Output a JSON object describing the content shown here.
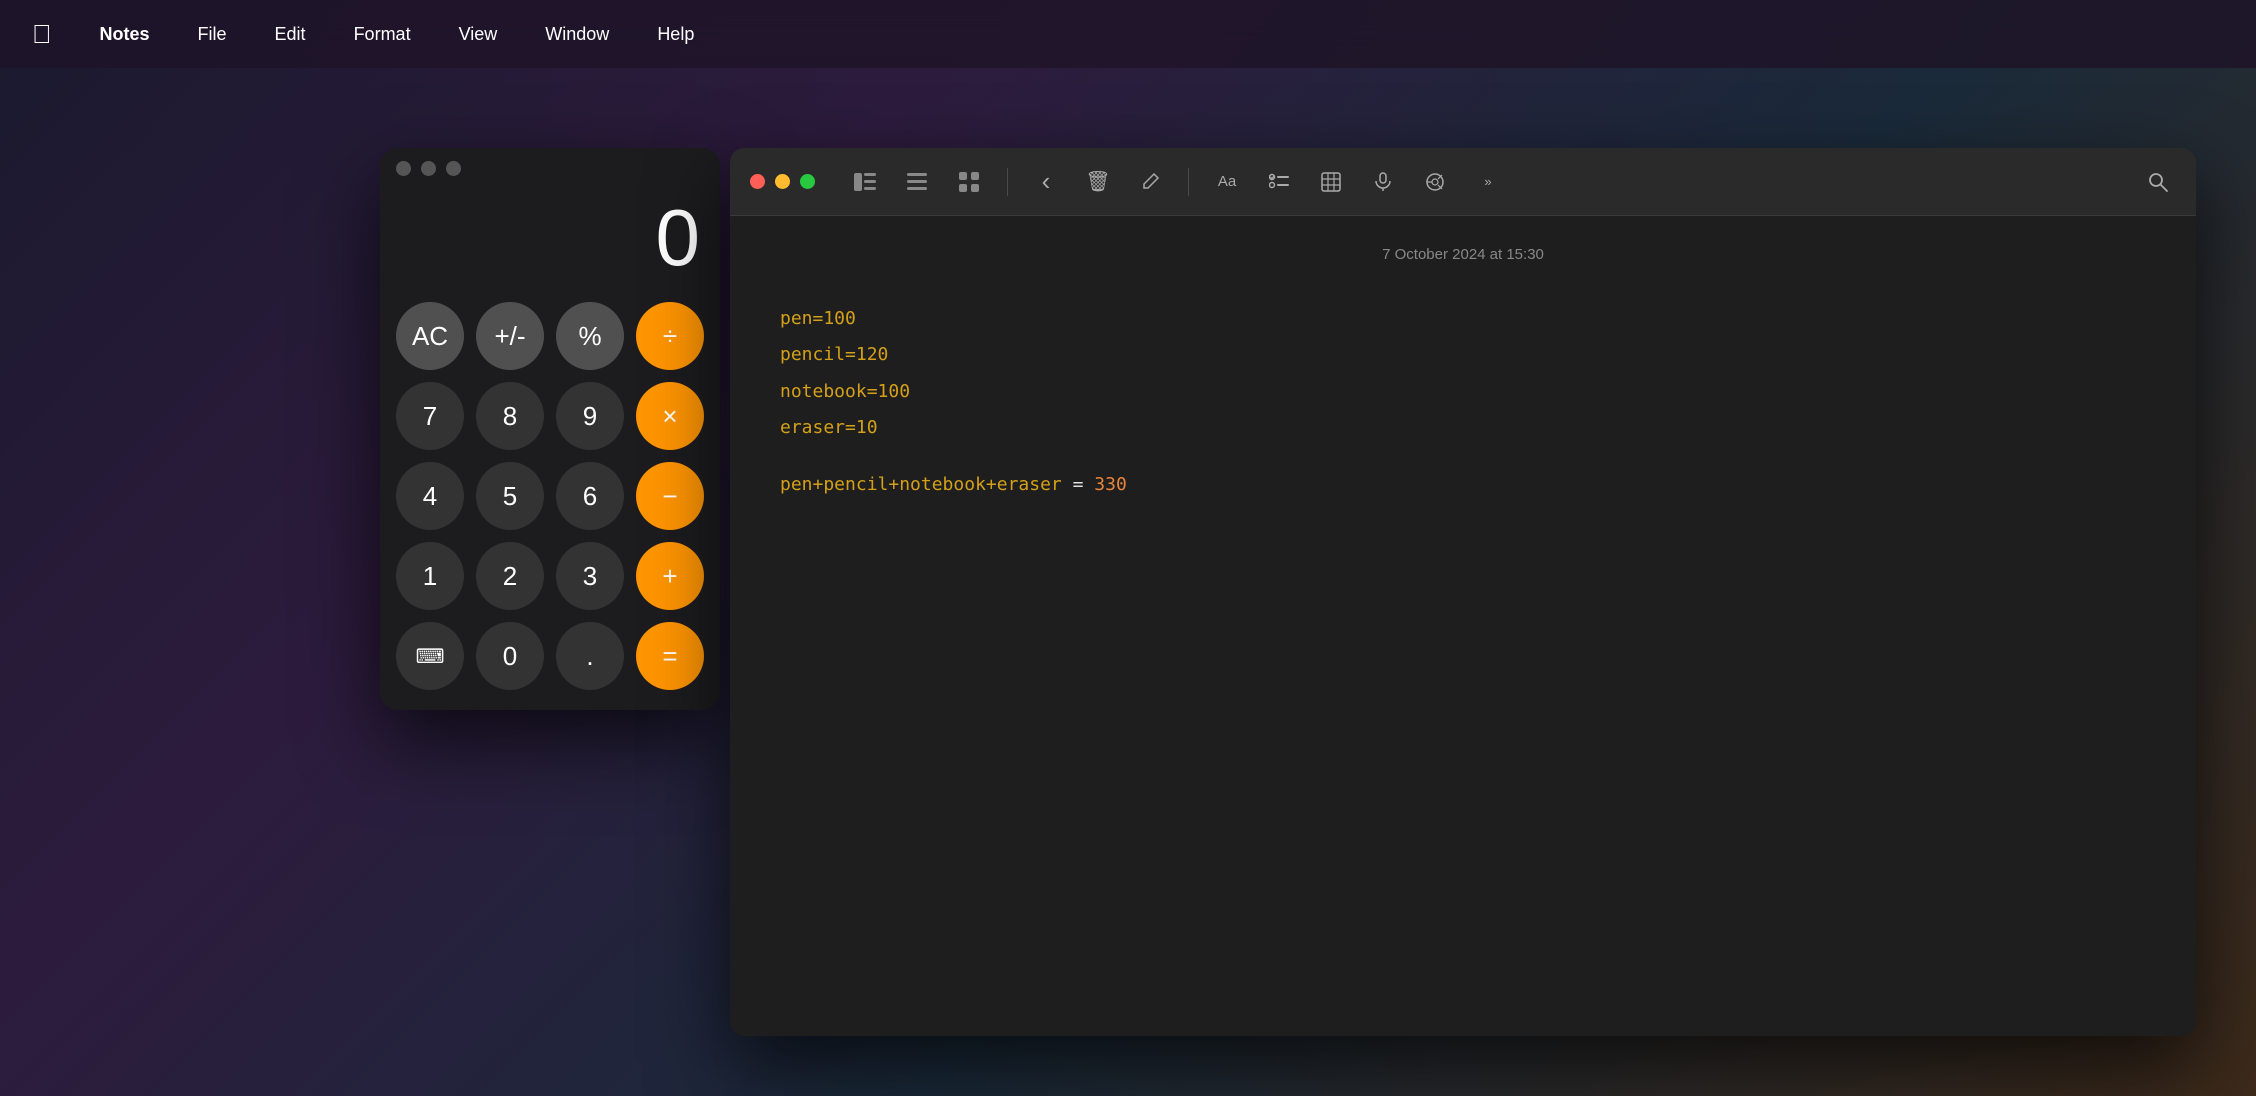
{
  "menubar": {
    "apple_icon": "&#63743;",
    "items": [
      {
        "label": "Notes",
        "active": true
      },
      {
        "label": "File"
      },
      {
        "label": "Edit"
      },
      {
        "label": "Format"
      },
      {
        "label": "View"
      },
      {
        "label": "Window"
      },
      {
        "label": "Help"
      }
    ]
  },
  "calculator": {
    "display": "0",
    "buttons": [
      {
        "label": "AC",
        "type": "gray"
      },
      {
        "label": "+/-",
        "type": "gray"
      },
      {
        "label": "%",
        "type": "gray"
      },
      {
        "label": "÷",
        "type": "orange"
      },
      {
        "label": "7",
        "type": "dark"
      },
      {
        "label": "8",
        "type": "dark"
      },
      {
        "label": "9",
        "type": "dark"
      },
      {
        "label": "×",
        "type": "orange"
      },
      {
        "label": "4",
        "type": "dark"
      },
      {
        "label": "5",
        "type": "dark"
      },
      {
        "label": "6",
        "type": "dark"
      },
      {
        "label": "−",
        "type": "orange"
      },
      {
        "label": "1",
        "type": "dark"
      },
      {
        "label": "2",
        "type": "dark"
      },
      {
        "label": "3",
        "type": "dark"
      },
      {
        "label": "+",
        "type": "orange"
      },
      {
        "label": "⌨",
        "type": "dark"
      },
      {
        "label": "0",
        "type": "dark"
      },
      {
        "label": ".",
        "type": "dark"
      },
      {
        "label": "=",
        "type": "orange"
      }
    ]
  },
  "notes": {
    "date": "7 October 2024 at 15:30",
    "lines": [
      {
        "text": "pen=100",
        "color": "yellow"
      },
      {
        "text": "pencil=120",
        "color": "yellow"
      },
      {
        "text": "notebook=100",
        "color": "yellow"
      },
      {
        "text": "eraser=10",
        "color": "yellow"
      }
    ],
    "formula": {
      "left": "pen+pencil+notebook+eraser",
      "equals": " = ",
      "result": "330"
    }
  },
  "toolbar": {
    "icons": [
      {
        "name": "sidebar-icon",
        "symbol": "⊟"
      },
      {
        "name": "list-icon",
        "symbol": "≡"
      },
      {
        "name": "grid-icon",
        "symbol": "⊞"
      },
      {
        "name": "back-icon",
        "symbol": "‹"
      },
      {
        "name": "delete-icon",
        "symbol": "🗑"
      },
      {
        "name": "compose-icon",
        "symbol": "✎"
      },
      {
        "name": "font-icon",
        "symbol": "Aa"
      },
      {
        "name": "checklist-icon",
        "symbol": "☑"
      },
      {
        "name": "table-icon",
        "symbol": "⊞"
      },
      {
        "name": "attachment-icon",
        "symbol": "▦"
      },
      {
        "name": "share-icon",
        "symbol": "⊕"
      },
      {
        "name": "more-icon",
        "symbol": ">>"
      },
      {
        "name": "search-icon",
        "symbol": "⌕"
      }
    ]
  }
}
